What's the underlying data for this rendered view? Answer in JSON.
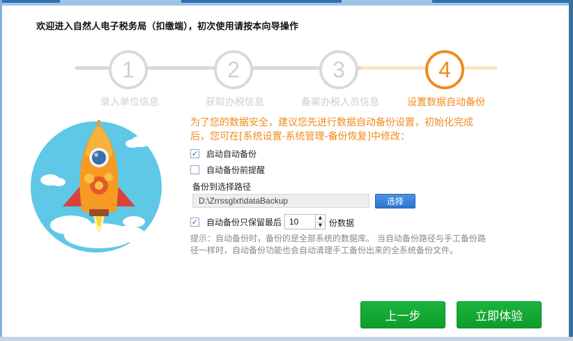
{
  "window": {
    "welcome_text": "欢迎进入自然人电子税务局（扣缴端），初次使用请按本向导操作"
  },
  "steps": [
    {
      "number": "1",
      "label": "录入单位信息",
      "state": "done"
    },
    {
      "number": "2",
      "label": "获取办税信息",
      "state": "done"
    },
    {
      "number": "3",
      "label": "备案办税人员信息",
      "state": "done"
    },
    {
      "number": "4",
      "label": "设置数据自动备份",
      "state": "active"
    }
  ],
  "colors": {
    "accent": "#f08a1c",
    "accent_light": "#fde3c8",
    "inactive": "#d9d9d9",
    "primary_button": "#1aad3a",
    "select_button": "#3a82da"
  },
  "backup": {
    "intro": "为了您的数据安全，建议您先进行数据自动备份设置，初始化完成后，您可在[系统设置-系统管理-备份恢复]中修改：",
    "enable_auto_backup": {
      "label": "启动自动备份",
      "checked": true
    },
    "remind_before_backup": {
      "label": "自动备份前提醒",
      "checked": false
    },
    "path_label": "备份到选择路径",
    "path_value": "D:\\Zrrssglxt\\dataBackup",
    "choose_button": "选择",
    "keep_latest": {
      "label": "自动备份只保留最后",
      "checked": true,
      "value": "10",
      "suffix": "份数据"
    },
    "hint": "提示：自动备份时，备份的是全部系统的数据库。 当自动备份路径与手工备份路径一样时，自动备份功能也会自动清理手工备份出来的全系统备份文件。"
  },
  "footer": {
    "prev_button": "上一步",
    "start_button": "立即体验"
  }
}
